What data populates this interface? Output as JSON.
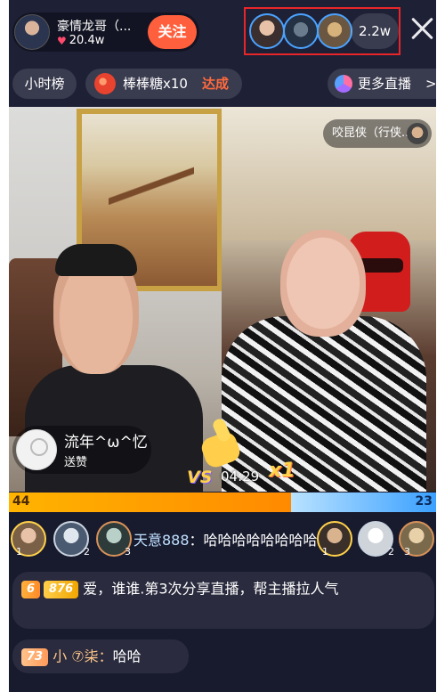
{
  "host": {
    "name": "豪情龙哥（...",
    "likes": "20.4w",
    "follow_label": "关注"
  },
  "viewers": {
    "count": "2.2w"
  },
  "subbar": {
    "hour_rank": "小时榜",
    "gift_label": "棒棒糖x10",
    "gift_status": "达成",
    "more_live": "更多直播",
    "more_chevron": ">"
  },
  "guest": {
    "name": "咬昆侠（行侠..."
  },
  "gift_popup": {
    "user": "流年^ω^忆",
    "action": "送赞"
  },
  "pk": {
    "vs": "VS",
    "timer": "04:29",
    "combo": "x1",
    "left_score": "44",
    "right_score": "23",
    "left_ratio": 0.66,
    "right_ratio": 0.34
  },
  "contributors": {
    "left_ranks": [
      "1",
      "2",
      "3"
    ],
    "right_ranks": [
      "1",
      "2",
      "3"
    ],
    "message_user": "天意888",
    "message_text": "：哈哈哈哈哈哈哈哈"
  },
  "chat": [
    {
      "level": "6",
      "badge": "876",
      "text": "爱，谁谁.第3次分享直播，帮主播拉人气"
    },
    {
      "level": "73",
      "user": "小 ⑦柒：",
      "text": "哈哈"
    }
  ],
  "colors": {
    "accent": "#ff5f3c",
    "pk_left": "#ffb400",
    "pk_right": "#3aa0ff",
    "highlight_box": "#e8262a"
  }
}
